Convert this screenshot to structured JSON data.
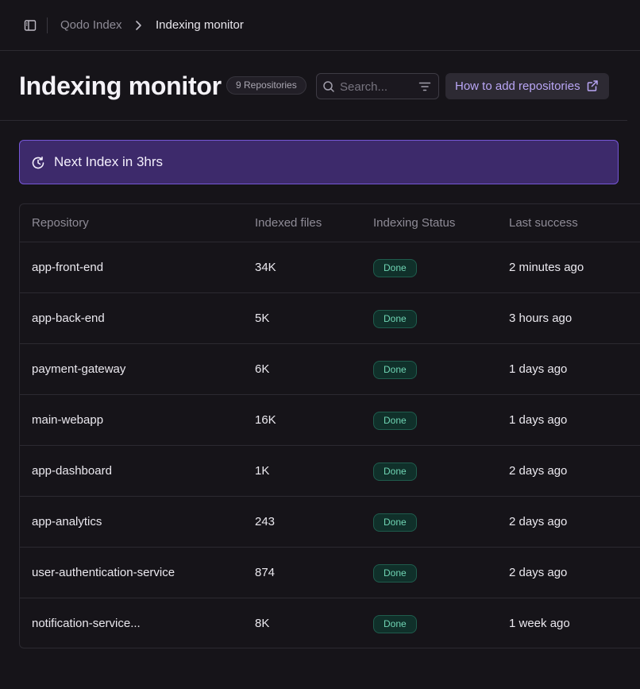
{
  "breadcrumb": {
    "root": "Qodo Index",
    "current": "Indexing monitor"
  },
  "header": {
    "title": "Indexing monitor",
    "repo_count": "9 Repositories",
    "search_placeholder": "Search...",
    "search_value": "",
    "howto_label": "How to add repositories"
  },
  "banner": {
    "text": "Next Index in 3hrs"
  },
  "table": {
    "columns": [
      "Repository",
      "Indexed files",
      "Indexing Status",
      "Last success"
    ],
    "rows": [
      {
        "repo": "app-front-end",
        "files": "34K",
        "status": "Done",
        "last": "2 minutes ago"
      },
      {
        "repo": "app-back-end",
        "files": "5K",
        "status": "Done",
        "last": "3 hours ago"
      },
      {
        "repo": "payment-gateway",
        "files": "6K",
        "status": "Done",
        "last": "1 days ago"
      },
      {
        "repo": "main-webapp",
        "files": "16K",
        "status": "Done",
        "last": "1 days ago"
      },
      {
        "repo": "app-dashboard",
        "files": "1K",
        "status": "Done",
        "last": "2 days ago"
      },
      {
        "repo": "app-analytics",
        "files": "243",
        "status": "Done",
        "last": "2 days ago"
      },
      {
        "repo": "user-authentication-service",
        "files": "874",
        "status": "Done",
        "last": "2 days ago"
      },
      {
        "repo": "notification-service...",
        "files": "8K",
        "status": "Done",
        "last": "1 week ago"
      }
    ]
  },
  "icons": {
    "sidebar_toggle": "sidebar-toggle-icon",
    "breadcrumb_separator": "chevron-right-icon",
    "search": "search-icon",
    "filter": "filter-icon",
    "external": "external-link-icon",
    "banner": "clock-refresh-icon"
  },
  "colors": {
    "background": "#161419",
    "banner_bg": "#3d2a6b",
    "banner_border": "#7657d6",
    "accent": "#b9a6f5",
    "status_done": "#6fd4b3"
  }
}
